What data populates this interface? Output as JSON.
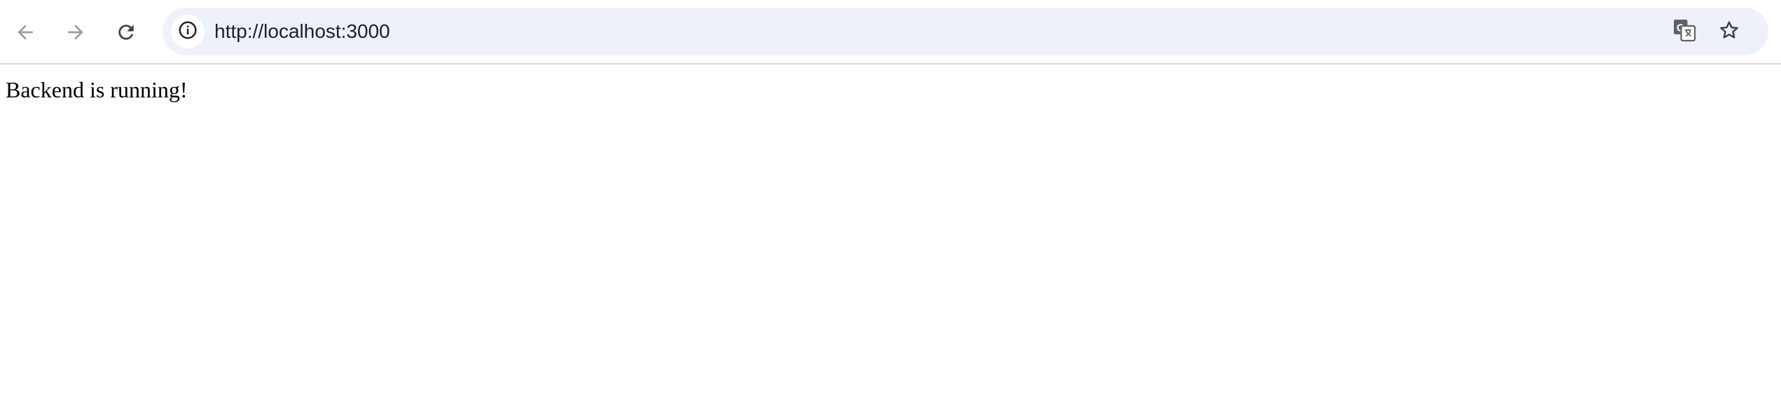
{
  "browser": {
    "url": "http://localhost:3000",
    "icons": {
      "back": "back-arrow-icon",
      "forward": "forward-arrow-icon",
      "reload": "reload-icon",
      "site_info": "info-icon",
      "translate": "translate-icon",
      "bookmark": "star-icon"
    },
    "colors": {
      "omnibox_bg": "#edf2fa",
      "disabled_icon": "#9aa0a6",
      "active_icon": "#3c4043"
    }
  },
  "page": {
    "message": "Backend is running!"
  }
}
